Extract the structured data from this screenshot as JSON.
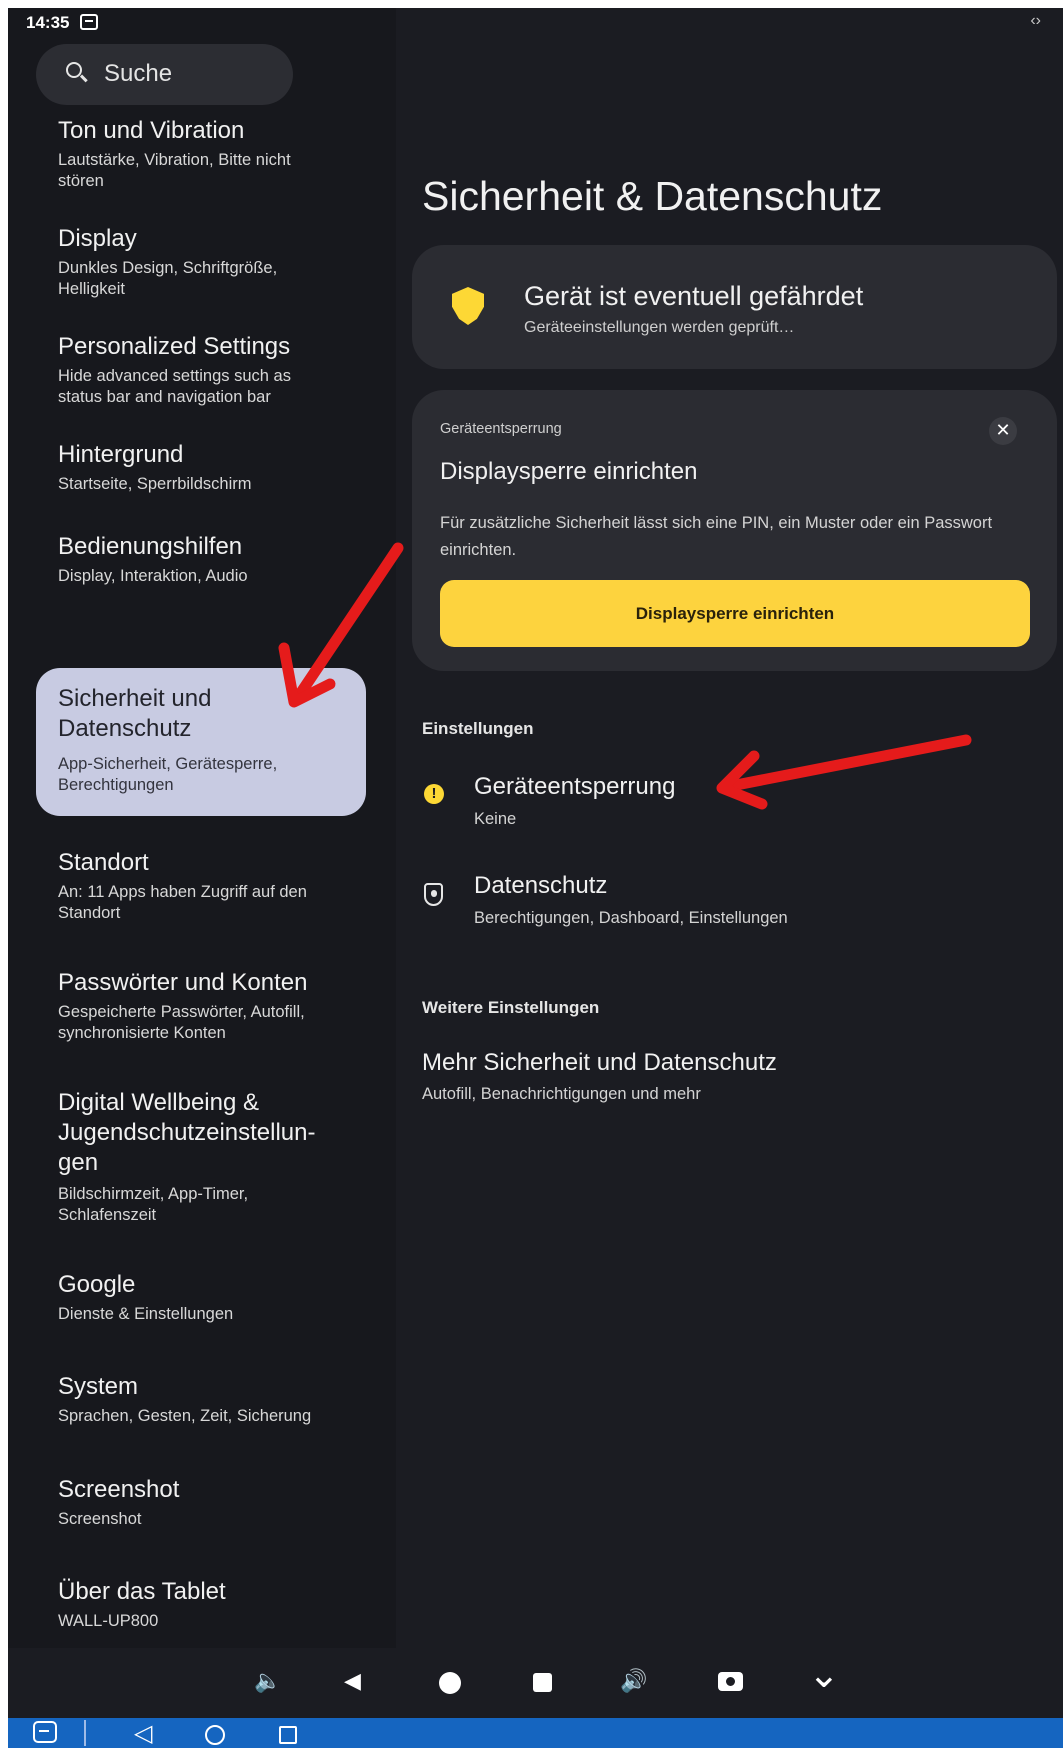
{
  "status_bar": {
    "time": "14:35",
    "expand_icon": "‹›"
  },
  "sidebar": {
    "search_label": "Suche",
    "items": [
      {
        "title": "Ton und Vibration",
        "subtitle": "Lautstärke, Vibration, Bitte nicht stören"
      },
      {
        "title": "Display",
        "subtitle": "Dunkles Design, Schriftgröße, Helligkeit"
      },
      {
        "title": "Personalized Settings",
        "subtitle": "Hide advanced settings such as status bar and navigation bar"
      },
      {
        "title": "Hintergrund",
        "subtitle": "Startseite, Sperrbildschirm"
      },
      {
        "title": "Bedienungshilfen",
        "subtitle": "Display, Interaktion, Audio"
      },
      {
        "title": "Sicherheit und Datenschutz",
        "subtitle": "App-Sicherheit, Gerätesperre, Berechtigungen"
      },
      {
        "title": "Standort",
        "subtitle": "An: 11 Apps haben Zugriff auf den Standort"
      },
      {
        "title": "Passwörter und Konten",
        "subtitle": "Gespeicherte Passwörter, Autofill, synchronisierte Konten"
      },
      {
        "title": "Digital Wellbeing & Jugendschutzeinstellun-gen",
        "subtitle": "Bildschirmzeit, App-Timer, Schlafenszeit"
      },
      {
        "title": "Google",
        "subtitle": "Dienste & Einstellungen"
      },
      {
        "title": "System",
        "subtitle": "Sprachen, Gesten, Zeit, Sicherung"
      },
      {
        "title": "Screenshot",
        "subtitle": "Screenshot"
      },
      {
        "title": "Über das Tablet",
        "subtitle": "WALL-UP800"
      }
    ]
  },
  "main": {
    "title": "Sicherheit & Datenschutz",
    "warning_card": {
      "title": "Gerät ist eventuell gefährdet",
      "subtitle": "Geräteeinstellungen werden geprüft…",
      "accent": "#fdd835"
    },
    "lock_card": {
      "eyebrow": "Geräteentsperrung",
      "title": "Displaysperre einrichten",
      "description": "Für zusätzliche Sicherheit lässt sich eine PIN, ein Muster oder ein Passwort einrichten.",
      "button_label": "Displaysperre einrichten",
      "close_label": "✕"
    },
    "settings_header": "Einstellungen",
    "settings": [
      {
        "title": "Geräteentsperrung",
        "subtitle": "Keine",
        "icon": "warning-icon"
      },
      {
        "title": "Datenschutz",
        "subtitle": "Berechtigungen, Dashboard, Einstellungen",
        "icon": "privacy-shield-icon"
      }
    ],
    "more_header": "Weitere Einstellungen",
    "more": {
      "title": "Mehr Sicherheit und Datenschutz",
      "subtitle": "Autofill, Benachrichtigungen und mehr"
    }
  },
  "bottom_controls": {
    "volume_down": "🔈",
    "back": "◀",
    "volume_up": "🔊",
    "collapse": "⌄"
  },
  "annotations": {
    "arrow_color": "#e51b1b"
  }
}
